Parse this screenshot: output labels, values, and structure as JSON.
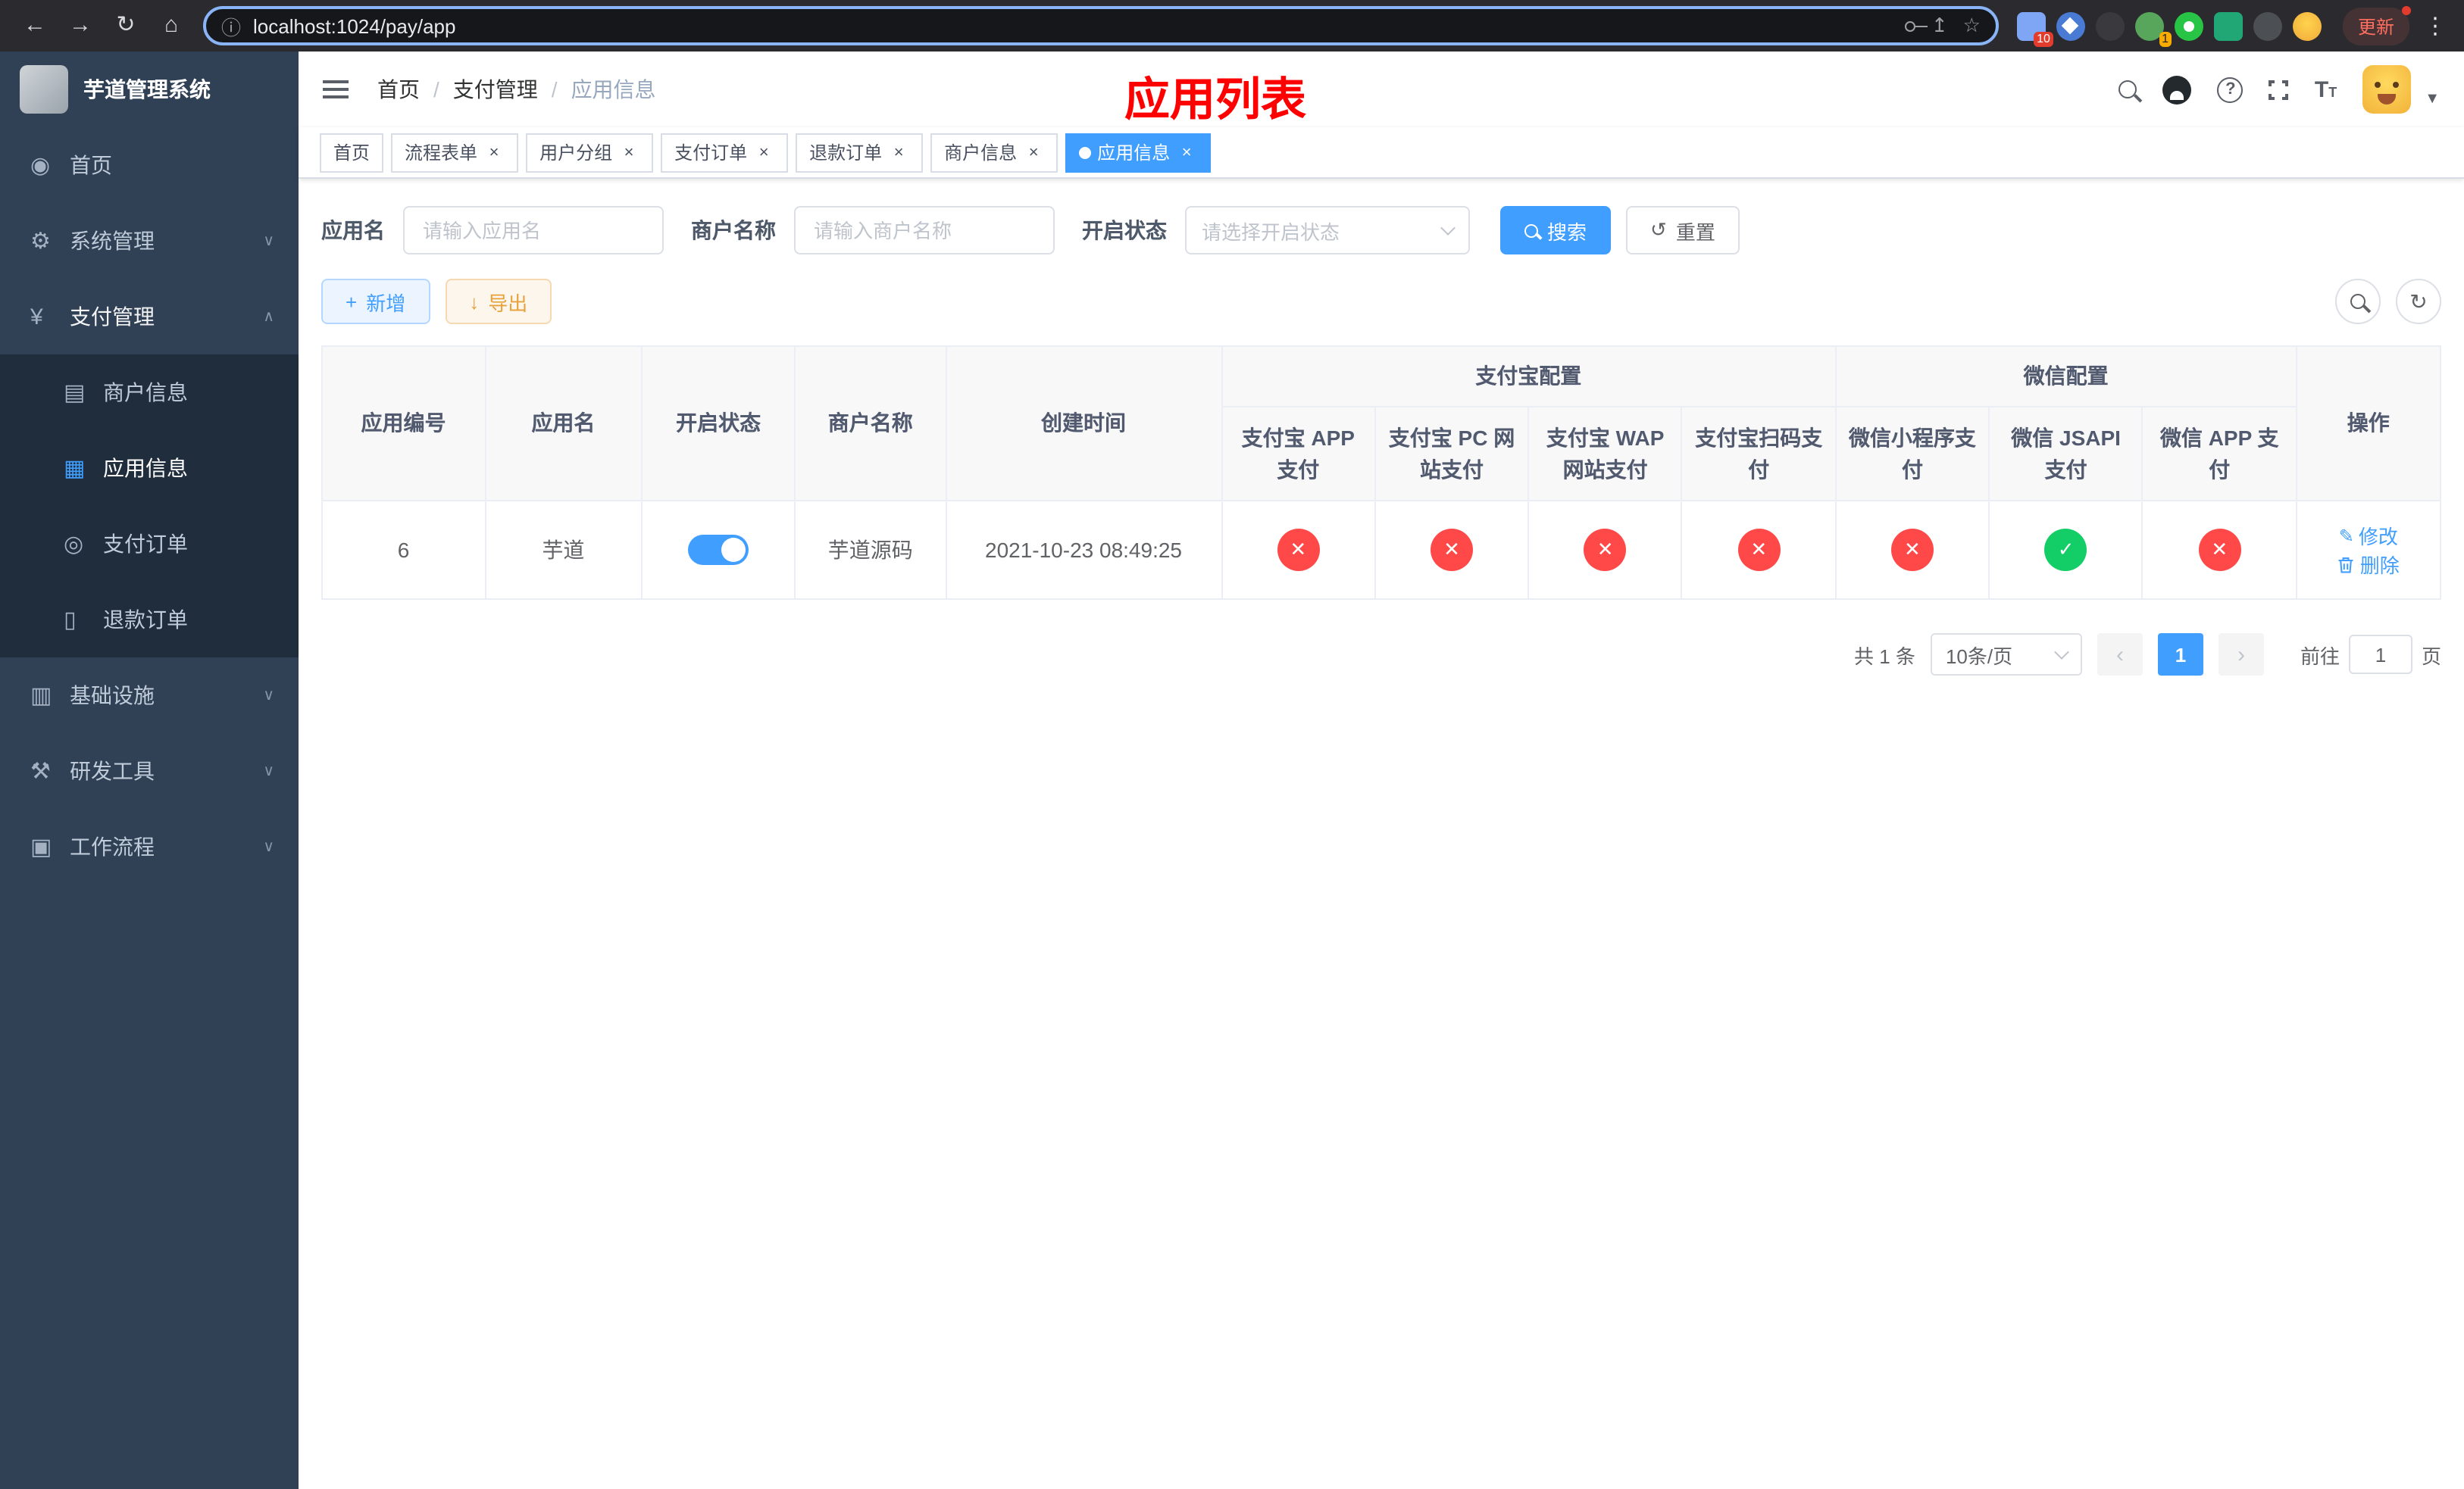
{
  "browser": {
    "url": "localhost:1024/pay/app",
    "update_label": "更新",
    "extensions_badge_a": "10",
    "extensions_badge_b": "1"
  },
  "sidebar": {
    "app_title": "芋道管理系统",
    "home": "首页",
    "system": "系统管理",
    "payment": "支付管理",
    "merchant_info": "商户信息",
    "app_info": "应用信息",
    "pay_order": "支付订单",
    "refund_order": "退款订单",
    "infrastructure": "基础设施",
    "dev_tools": "研发工具",
    "workflow": "工作流程"
  },
  "header": {
    "breadcrumb": [
      "首页",
      "支付管理",
      "应用信息"
    ],
    "page_title": "应用列表"
  },
  "tabs": [
    {
      "label": "首页"
    },
    {
      "label": "流程表单"
    },
    {
      "label": "用户分组"
    },
    {
      "label": "支付订单"
    },
    {
      "label": "退款订单"
    },
    {
      "label": "商户信息"
    },
    {
      "label": "应用信息"
    }
  ],
  "filters": {
    "app_name_label": "应用名",
    "app_name_placeholder": "请输入应用名",
    "merchant_label": "商户名称",
    "merchant_placeholder": "请输入商户名称",
    "status_label": "开启状态",
    "status_placeholder": "请选择开启状态",
    "search_button": "搜索",
    "reset_button": "重置"
  },
  "toolbar": {
    "add_button": "新增",
    "export_button": "导出"
  },
  "table": {
    "columns": {
      "app_id": "应用编号",
      "app_name": "应用名",
      "status": "开启状态",
      "merchant_name": "商户名称",
      "create_time": "创建时间",
      "alipay_group": "支付宝配置",
      "wechat_group": "微信配置",
      "alipay_app": "支付宝 APP 支付",
      "alipay_pc": "支付宝 PC 网站支付",
      "alipay_wap": "支付宝 WAP 网站支付",
      "alipay_qr": "支付宝扫码支付",
      "wechat_mini": "微信小程序支付",
      "wechat_jsapi": "微信 JSAPI 支付",
      "wechat_app": "微信 APP 支付",
      "actions": "操作"
    },
    "rows": [
      {
        "app_id": "6",
        "app_name": "芋道",
        "status_enabled": true,
        "merchant_name": "芋道源码",
        "create_time": "2021-10-23 08:49:25",
        "configs": {
          "alipay_app": false,
          "alipay_pc": false,
          "alipay_wap": false,
          "alipay_qr": false,
          "wechat_mini": false,
          "wechat_jsapi": true,
          "wechat_app": false
        },
        "edit_label": "修改",
        "delete_label": "删除"
      }
    ]
  },
  "pagination": {
    "total_label": "共 1 条",
    "page_size_label": "10条/页",
    "current_page": "1",
    "goto_label": "前往",
    "goto_value": "1",
    "page_unit_label": "页"
  },
  "colors": {
    "primary": "#409eff",
    "danger": "#ff4949",
    "success": "#13ce66",
    "title_red": "#ff0000",
    "sidebar_bg": "#304156",
    "submenu_bg": "#1f2d3d"
  }
}
